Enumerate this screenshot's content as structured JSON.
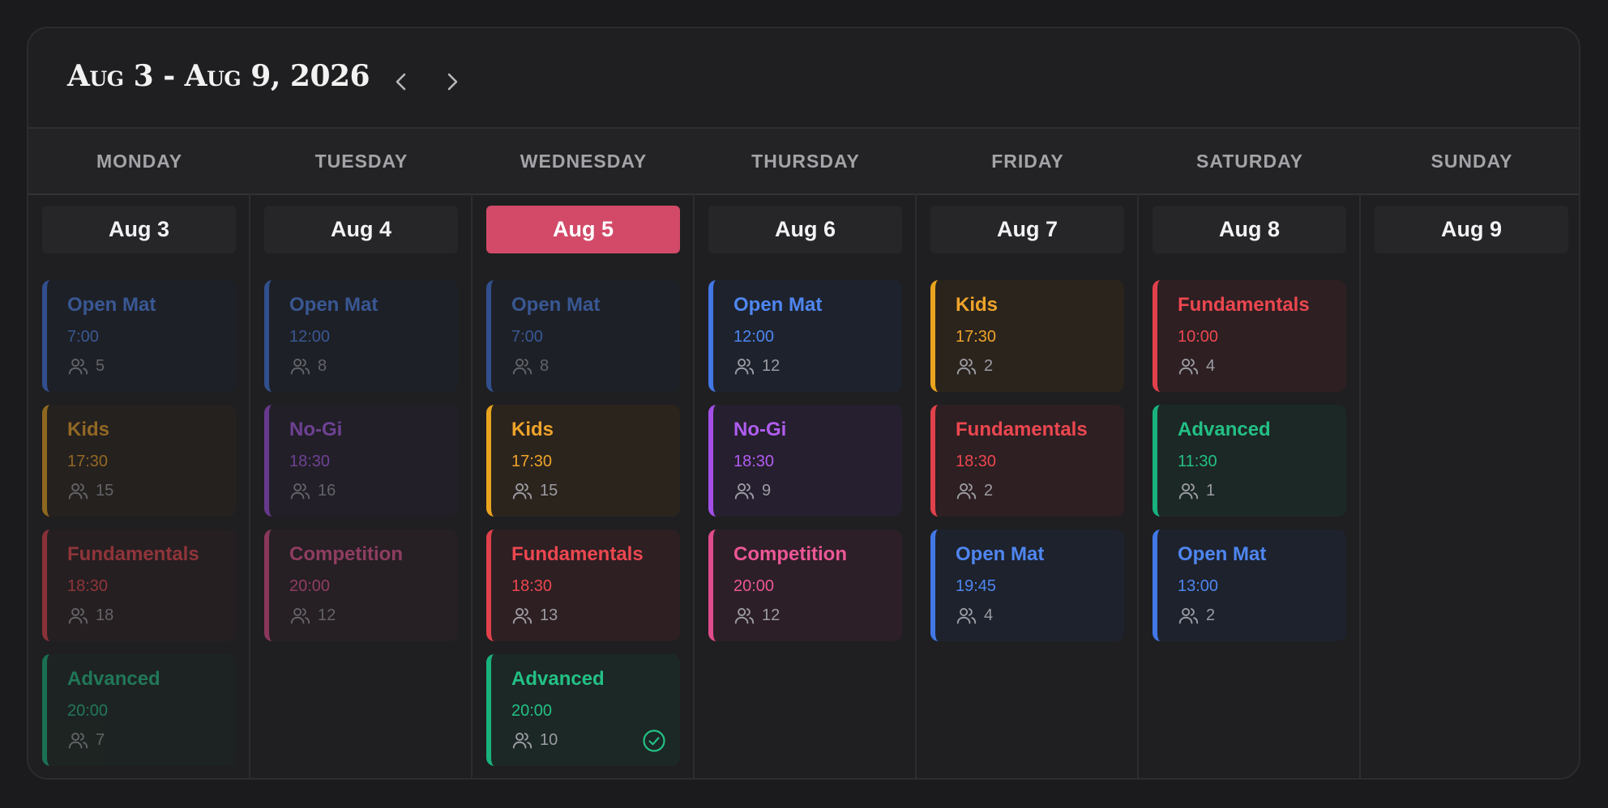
{
  "header": {
    "title": "Aug 3 - Aug 9, 2026",
    "prev_icon": "chevron-left-icon",
    "next_icon": "chevron-right-icon"
  },
  "weekdays": [
    "MONDAY",
    "TUESDAY",
    "WEDNESDAY",
    "THURSDAY",
    "FRIDAY",
    "SATURDAY",
    "SUNDAY"
  ],
  "dates": [
    "Aug 3",
    "Aug 4",
    "Aug 5",
    "Aug 6",
    "Aug 7",
    "Aug 8",
    "Aug 9"
  ],
  "today_index": 2,
  "colors": {
    "today": "#d24a68",
    "blue": "#4f86f0",
    "orange": "#f0a42a",
    "red": "#ec4750",
    "purple": "#b05df0",
    "pink": "#ec5796",
    "green": "#23c085"
  },
  "days": [
    {
      "sessions": [
        {
          "name": "Open Mat",
          "time": "7:00",
          "count": "5",
          "color": "blue",
          "past": true
        },
        {
          "name": "Kids",
          "time": "17:30",
          "count": "15",
          "color": "orange",
          "past": true
        },
        {
          "name": "Fundamentals",
          "time": "18:30",
          "count": "18",
          "color": "red",
          "past": true
        },
        {
          "name": "Advanced",
          "time": "20:00",
          "count": "7",
          "color": "green",
          "past": true
        }
      ]
    },
    {
      "sessions": [
        {
          "name": "Open Mat",
          "time": "12:00",
          "count": "8",
          "color": "blue",
          "past": true
        },
        {
          "name": "No-Gi",
          "time": "18:30",
          "count": "16",
          "color": "purple",
          "past": true
        },
        {
          "name": "Competition",
          "time": "20:00",
          "count": "12",
          "color": "pink",
          "past": true
        }
      ]
    },
    {
      "sessions": [
        {
          "name": "Open Mat",
          "time": "7:00",
          "count": "8",
          "color": "blue",
          "past": true
        },
        {
          "name": "Kids",
          "time": "17:30",
          "count": "15",
          "color": "orange",
          "past": false
        },
        {
          "name": "Fundamentals",
          "time": "18:30",
          "count": "13",
          "color": "red",
          "past": false
        },
        {
          "name": "Advanced",
          "time": "20:00",
          "count": "10",
          "color": "green",
          "past": false,
          "checked": true
        }
      ]
    },
    {
      "sessions": [
        {
          "name": "Open Mat",
          "time": "12:00",
          "count": "12",
          "color": "blue",
          "past": false
        },
        {
          "name": "No-Gi",
          "time": "18:30",
          "count": "9",
          "color": "purple",
          "past": false
        },
        {
          "name": "Competition",
          "time": "20:00",
          "count": "12",
          "color": "pink",
          "past": false
        }
      ]
    },
    {
      "sessions": [
        {
          "name": "Kids",
          "time": "17:30",
          "count": "2",
          "color": "orange",
          "past": false
        },
        {
          "name": "Fundamentals",
          "time": "18:30",
          "count": "2",
          "color": "red",
          "past": false
        },
        {
          "name": "Open Mat",
          "time": "19:45",
          "count": "4",
          "color": "blue",
          "past": false
        }
      ]
    },
    {
      "sessions": [
        {
          "name": "Fundamentals",
          "time": "10:00",
          "count": "4",
          "color": "red",
          "past": false
        },
        {
          "name": "Advanced",
          "time": "11:30",
          "count": "1",
          "color": "green",
          "past": false
        },
        {
          "name": "Open Mat",
          "time": "13:00",
          "count": "2",
          "color": "blue",
          "past": false
        }
      ]
    },
    {
      "sessions": []
    }
  ]
}
